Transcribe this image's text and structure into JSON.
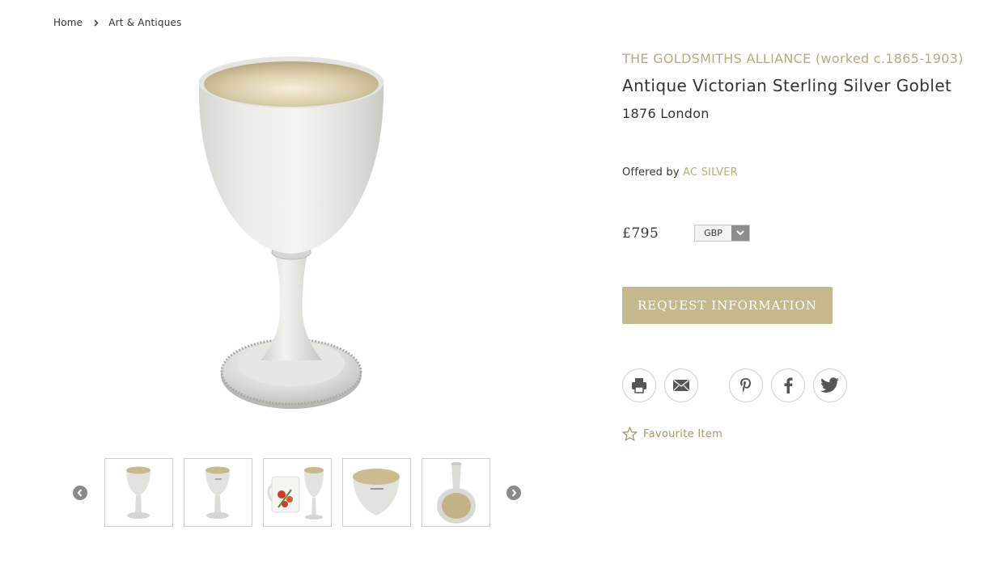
{
  "breadcrumb": {
    "home": "Home",
    "category": "Art & Antiques"
  },
  "product": {
    "maker": "THE GOLDSMITHS ALLIANCE (worked c.1865-1903)",
    "title": "Antique Victorian Sterling Silver Goblet",
    "subtitle": "1876 London",
    "offered_by_label": "Offered by",
    "dealer": "AC SILVER",
    "price": "£795",
    "currency": "GBP",
    "request_label": "REQUEST INFORMATION",
    "favourite_label": "Favourite Item"
  },
  "share_icons": [
    "print-icon",
    "email-icon",
    "pinterest-icon",
    "facebook-icon",
    "twitter-icon"
  ],
  "thumbnails": [
    "goblet-front",
    "goblet-side",
    "goblet-with-mug",
    "goblet-bowl-interior",
    "goblet-base"
  ],
  "colors": {
    "accent_gold": "#bca97c",
    "button": "#c5b88d",
    "text": "#333333"
  }
}
